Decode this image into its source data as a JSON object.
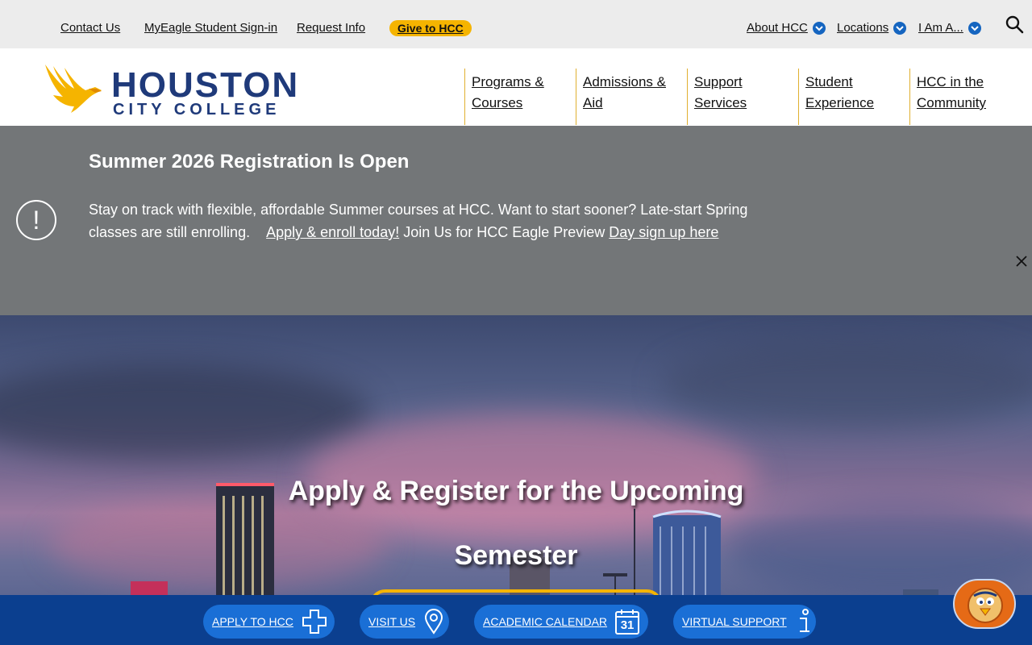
{
  "utility_nav": {
    "links": [
      "Contact Us",
      "MyEagle Student Sign-in",
      "Request Info"
    ],
    "give_label": "Give to HCC",
    "dropdowns": [
      "About HCC",
      "Locations",
      "I Am A..."
    ]
  },
  "brand": {
    "line1": "HOUSTON",
    "line2": "CITY COLLEGE"
  },
  "main_nav": [
    {
      "line1": "Programs &",
      "line2": "Courses"
    },
    {
      "line1": "Admissions &",
      "line2": "Aid"
    },
    {
      "line1": "Support",
      "line2": "Services"
    },
    {
      "line1": "Student",
      "line2": "Experience"
    },
    {
      "line1": "HCC in the",
      "line2": "Community"
    }
  ],
  "alert": {
    "icon_glyph": "!",
    "title": "Summer 2026 Registration Is Open",
    "body_1": "Stay on track with flexible, affordable Summer courses at HCC. Want to start sooner? Late-start Spring classes are still enrolling.",
    "link_1": "Apply & enroll today!",
    "body_2": " Join Us for HCC Eagle Preview ",
    "link_2": "Day sign up here"
  },
  "hero": {
    "title": "Apply & Register for the Upcoming Semester"
  },
  "quick_links": [
    {
      "label": "APPLY TO HCC",
      "icon": "plus-icon"
    },
    {
      "label": "VISIT US",
      "icon": "map-pin-icon"
    },
    {
      "label": "ACADEMIC CALENDAR",
      "icon": "calendar-icon",
      "icon_text": "31"
    },
    {
      "label": "VIRTUAL SUPPORT",
      "icon": "info-icon"
    }
  ],
  "colors": {
    "brand_blue": "#1f3a7a",
    "gold": "#f5b400",
    "alert_gray": "#737678",
    "bar_blue": "#0b3f8f",
    "pill_blue": "#1a6fd6"
  }
}
